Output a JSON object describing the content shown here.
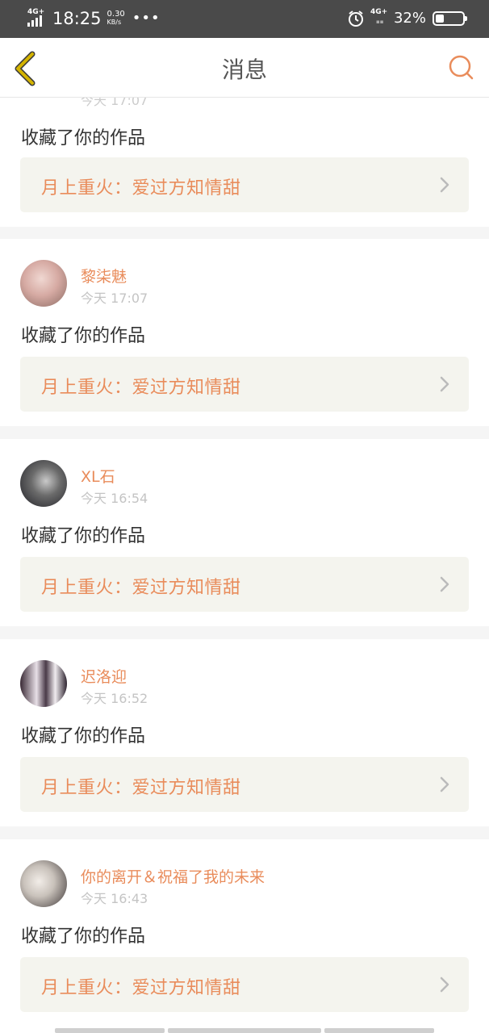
{
  "status_bar": {
    "network_left": "4G+",
    "time": "18:25",
    "speed_value": "0.30",
    "speed_unit": "KB/s",
    "more_dots": "•••",
    "network_right": "4G+",
    "battery_percent": "32%",
    "battery_level": 0.32
  },
  "header": {
    "title": "消息",
    "back_icon": "chevron-left-icon",
    "search_icon": "search-icon"
  },
  "partial_top": {
    "meta": "今天 17:07",
    "action_text": "收藏了你的作品",
    "work_title": "月上重火：爱过方知情甜"
  },
  "messages": [
    {
      "username": "黎柒魅",
      "time": "今天 17:07",
      "action_text": "收藏了你的作品",
      "work_title": "月上重火：爱过方知情甜"
    },
    {
      "username": "XL石",
      "time": "今天 16:54",
      "action_text": "收藏了你的作品",
      "work_title": "月上重火：爱过方知情甜"
    },
    {
      "username": "迟洛迎",
      "time": "今天 16:52",
      "action_text": "收藏了你的作品",
      "work_title": "月上重火：爱过方知情甜"
    },
    {
      "username": "你的离开＆祝福了我的未来",
      "time": "今天 16:43",
      "action_text": "收藏了你的作品",
      "work_title": "月上重火：爱过方知情甜"
    }
  ],
  "colors": {
    "accent": "#e98c5b",
    "back_icon": "#d4b400",
    "status_bar": "#4a4a4a",
    "work_box_bg": "#f4f4ee"
  }
}
